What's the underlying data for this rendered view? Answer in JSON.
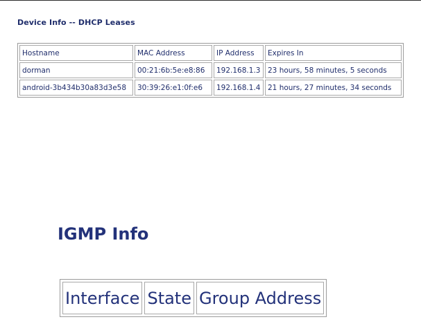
{
  "dhcp": {
    "title": "Device Info -- DHCP Leases",
    "headers": [
      "Hostname",
      "MAC Address",
      "IP Address",
      "Expires In"
    ],
    "rows": [
      [
        "dorman",
        "00:21:6b:5e:e8:86",
        "192.168.1.3",
        "23 hours, 58 minutes, 5 seconds"
      ],
      [
        "android-3b434b30a83d3e58",
        "30:39:26:e1:0f:e6",
        "192.168.1.4",
        "21 hours, 27 minutes, 34 seconds"
      ]
    ]
  },
  "igmp": {
    "title": "IGMP Info",
    "headers": [
      "Interface",
      "State",
      "Group Address"
    ]
  },
  "colors": {
    "text": "#1f2d6b",
    "border": "#a8a8a8"
  }
}
